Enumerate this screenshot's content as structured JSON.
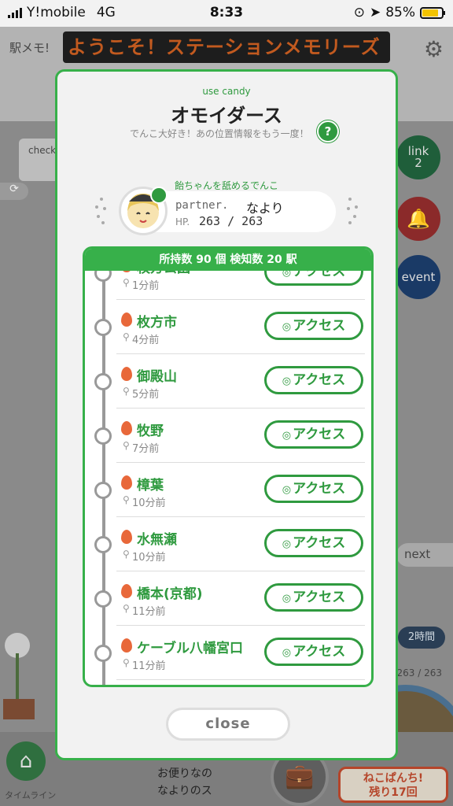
{
  "statusbar": {
    "carrier": "Y!mobile",
    "network": "4G",
    "time": "8:33",
    "battery": "85%"
  },
  "background": {
    "logo": "駅メモ!",
    "marquee": "ようこそ！ステーションメモリーズ",
    "check_label": "check",
    "link_label": "link",
    "link_count": "2",
    "event_label": "event",
    "next_label": "next",
    "time_badge": "2時間",
    "hp_text": "263 / 263",
    "timeline_label": "タイムライン",
    "message_line1": "お便りなの",
    "message_line2": "なよりのス",
    "nekopanchi_line1": "ねこぱんち!",
    "nekopanchi_line2": "残り17回"
  },
  "modal": {
    "subtitle": "use candy",
    "title": "オモイダース",
    "description": "でんこ大好き！あの位置情報をもう一度！",
    "help_label": "?",
    "partner_caption": "飴ちゃんを舐めるでんこ",
    "partner_label": "partner.",
    "partner_name": "なより",
    "hp_label": "HP.",
    "hp_value": "263 / 263",
    "list_header": "所持数 90 個 検知数 20 駅",
    "access_label": "アクセス",
    "close_label": "close",
    "stations": [
      {
        "name": "枚方公園",
        "time": "1分前"
      },
      {
        "name": "枚方市",
        "time": "4分前"
      },
      {
        "name": "御殿山",
        "time": "5分前"
      },
      {
        "name": "牧野",
        "time": "7分前"
      },
      {
        "name": "樟葉",
        "time": "10分前"
      },
      {
        "name": "水無瀬",
        "time": "10分前"
      },
      {
        "name": "橋本(京都)",
        "time": "11分前"
      },
      {
        "name": "ケーブル八幡宮口",
        "time": "11分前"
      }
    ]
  },
  "colors": {
    "accent": "#37b04a",
    "accent_dark": "#2f9a3f",
    "flame": "#e8683a"
  }
}
